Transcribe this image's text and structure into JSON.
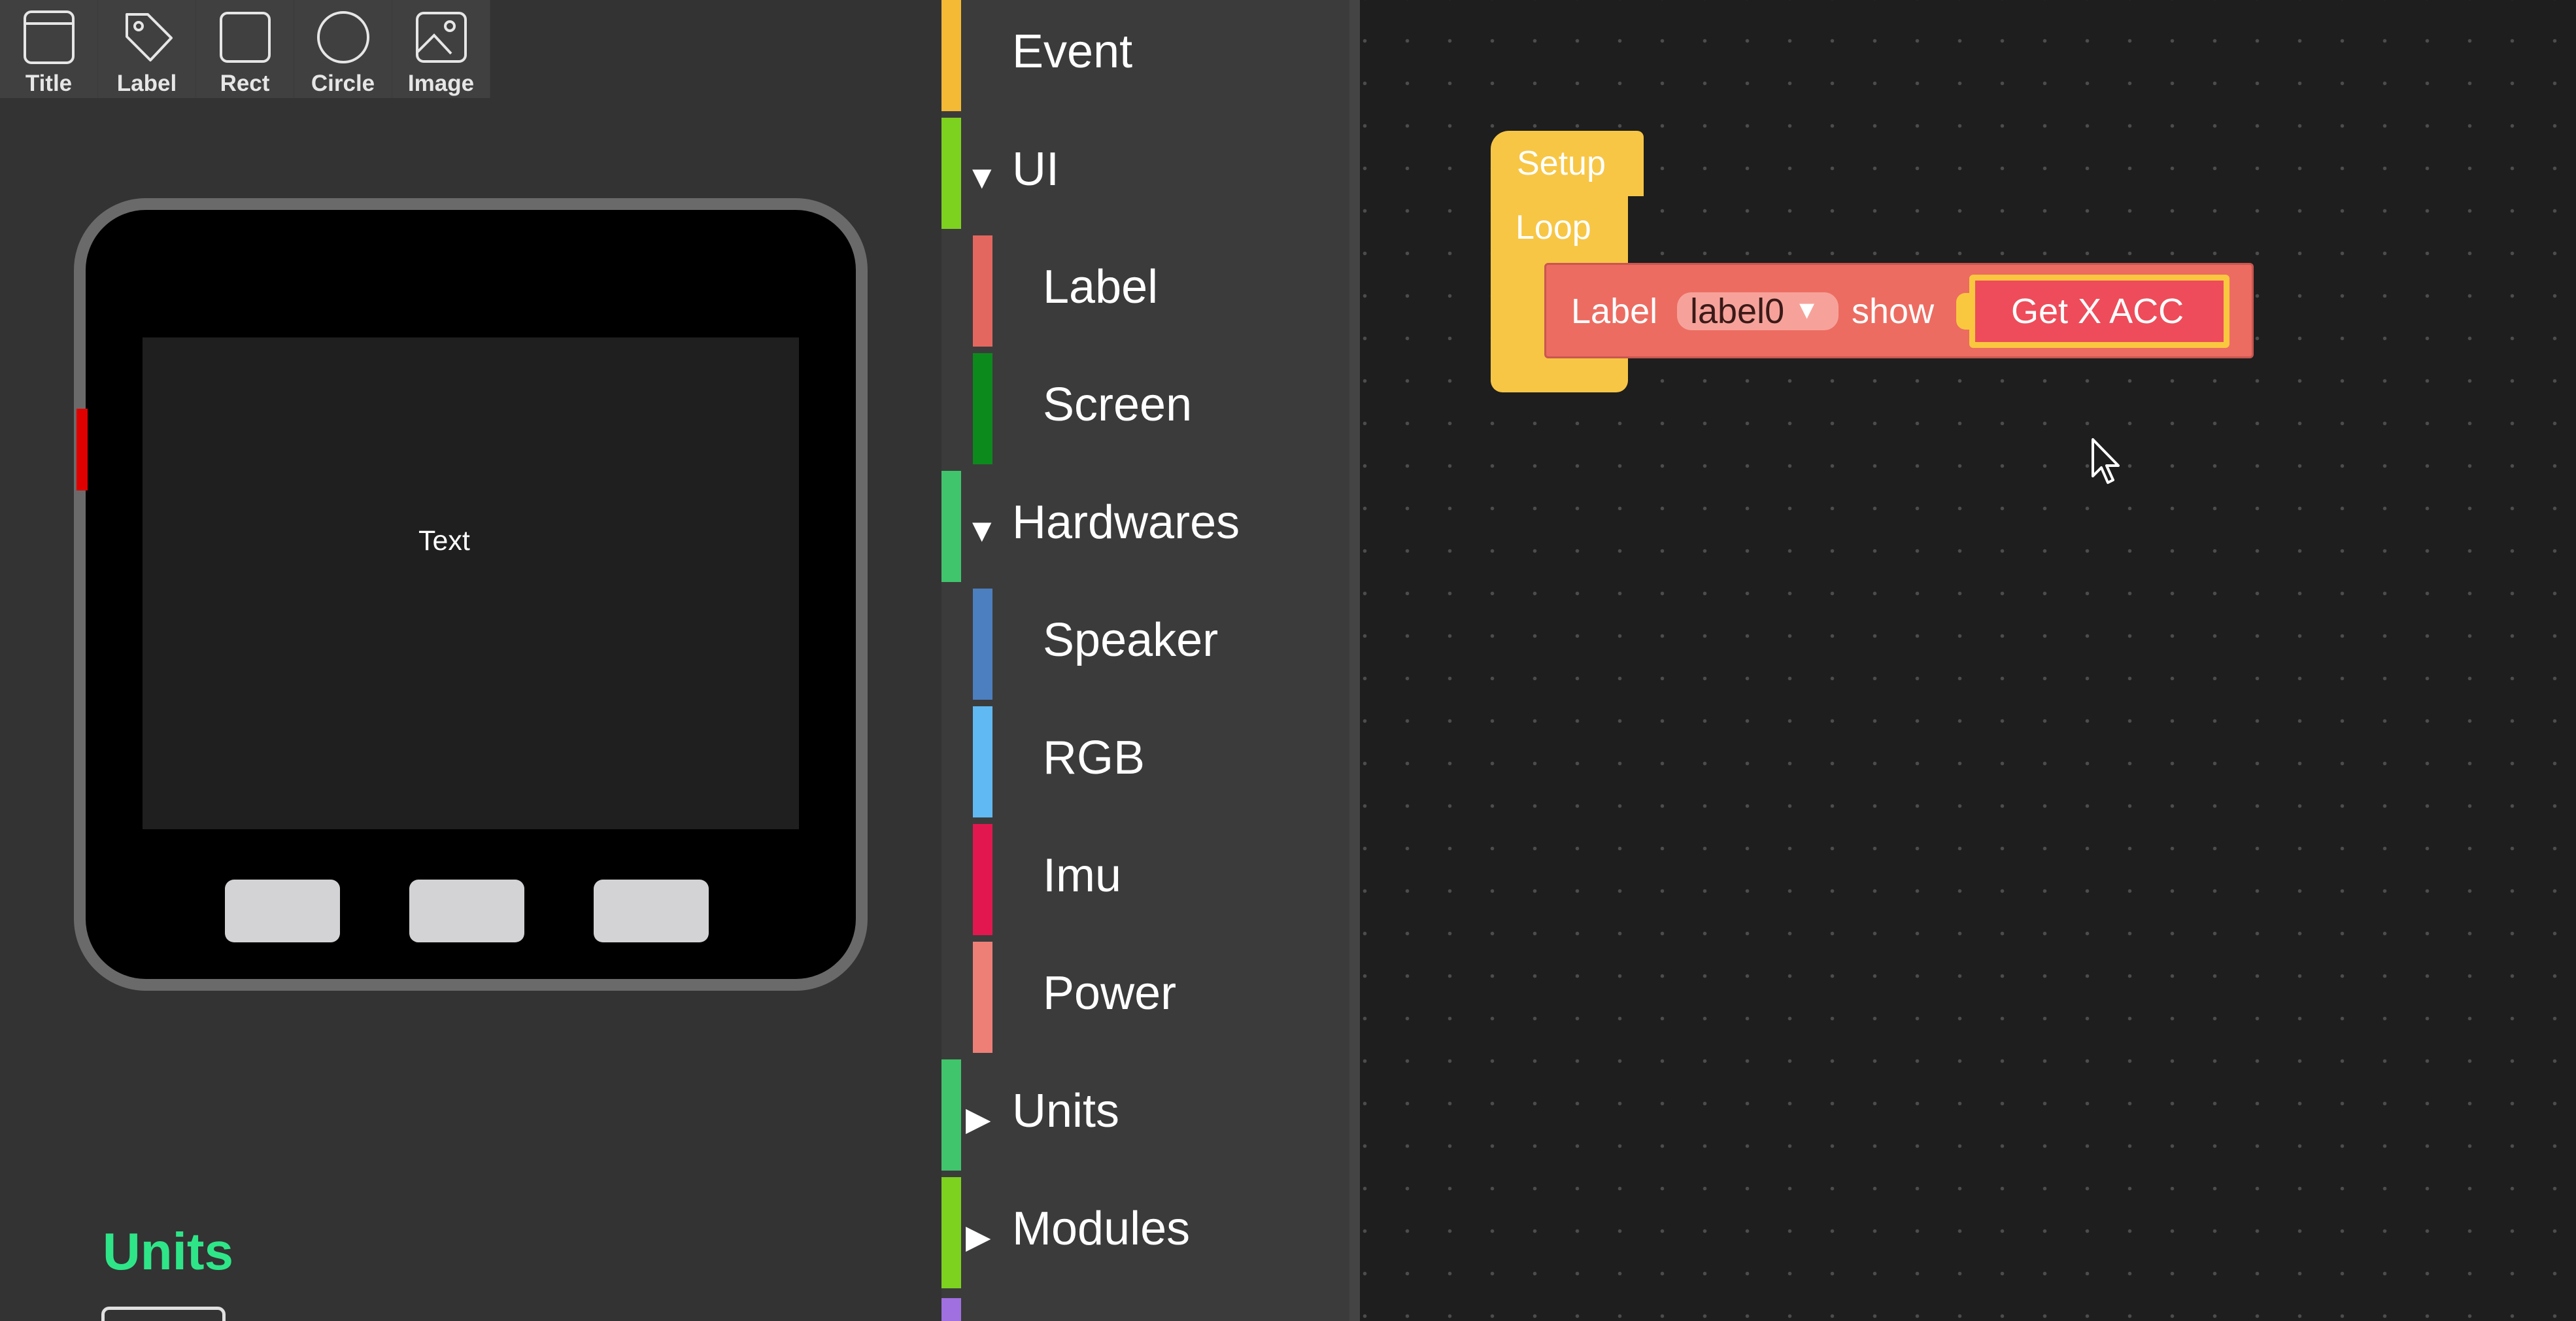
{
  "toolbar": {
    "items": [
      {
        "label": "Title",
        "icon": "title-icon"
      },
      {
        "label": "Label",
        "icon": "tag-icon"
      },
      {
        "label": "Rect",
        "icon": "rect-icon"
      },
      {
        "label": "Circle",
        "icon": "circle-icon"
      },
      {
        "label": "Image",
        "icon": "image-icon"
      }
    ]
  },
  "device": {
    "screen_text": "Text"
  },
  "units_panel": {
    "heading": "Units"
  },
  "categories": {
    "items": [
      {
        "label": "Event",
        "color": "#f4b935"
      },
      {
        "label": "UI",
        "color": "#7dd11f",
        "expanded": true
      },
      {
        "label": "Label",
        "color": "#e4675f",
        "child": true
      },
      {
        "label": "Screen",
        "color": "#0c8a1c",
        "child": true
      },
      {
        "label": "Hardwares",
        "color": "#40c56c",
        "expanded": true
      },
      {
        "label": "Speaker",
        "color": "#4c7fbf",
        "child": true
      },
      {
        "label": "RGB",
        "color": "#60b9f2",
        "child": true
      },
      {
        "label": "Imu",
        "color": "#e3174f",
        "child": true
      },
      {
        "label": "Power",
        "color": "#ee7f77",
        "child": true
      },
      {
        "label": "Units",
        "color": "#40c56c",
        "expanded": false
      },
      {
        "label": "Modules",
        "color": "#7dd11f",
        "expanded": false
      }
    ],
    "expanded_glyph": "▼",
    "collapsed_glyph": "▶",
    "next_color": "#a070e0"
  },
  "workspace": {
    "setup_label": "Setup",
    "loop_label": "Loop",
    "label_block": {
      "prefix": "Label",
      "dropdown_value": "label0",
      "dropdown_arrow": "▾",
      "action": "show",
      "value_block": "Get X ACC"
    },
    "colors": {
      "event_block": "#f7c645",
      "label_block": "#ec6c61",
      "value_block": "#ee4c5a",
      "highlight": "#f9c83f"
    }
  }
}
